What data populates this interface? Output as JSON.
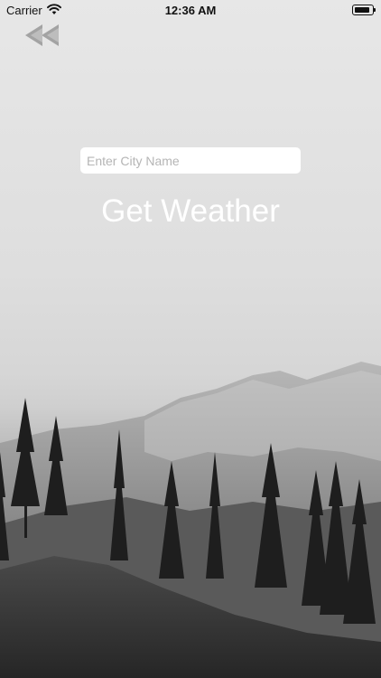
{
  "status_bar": {
    "carrier": "Carrier",
    "time": "12:36 AM",
    "icons": [
      "wifi-icon",
      "battery-icon"
    ]
  },
  "nav": {
    "back_icon": "double-chevron-left-icon"
  },
  "search": {
    "placeholder": "Enter City Name",
    "value": ""
  },
  "action": {
    "get_weather_label": "Get Weather"
  },
  "colors": {
    "text_on_image": "#ffffff",
    "input_bg": "#ffffff",
    "placeholder": "#b5b5b5"
  }
}
